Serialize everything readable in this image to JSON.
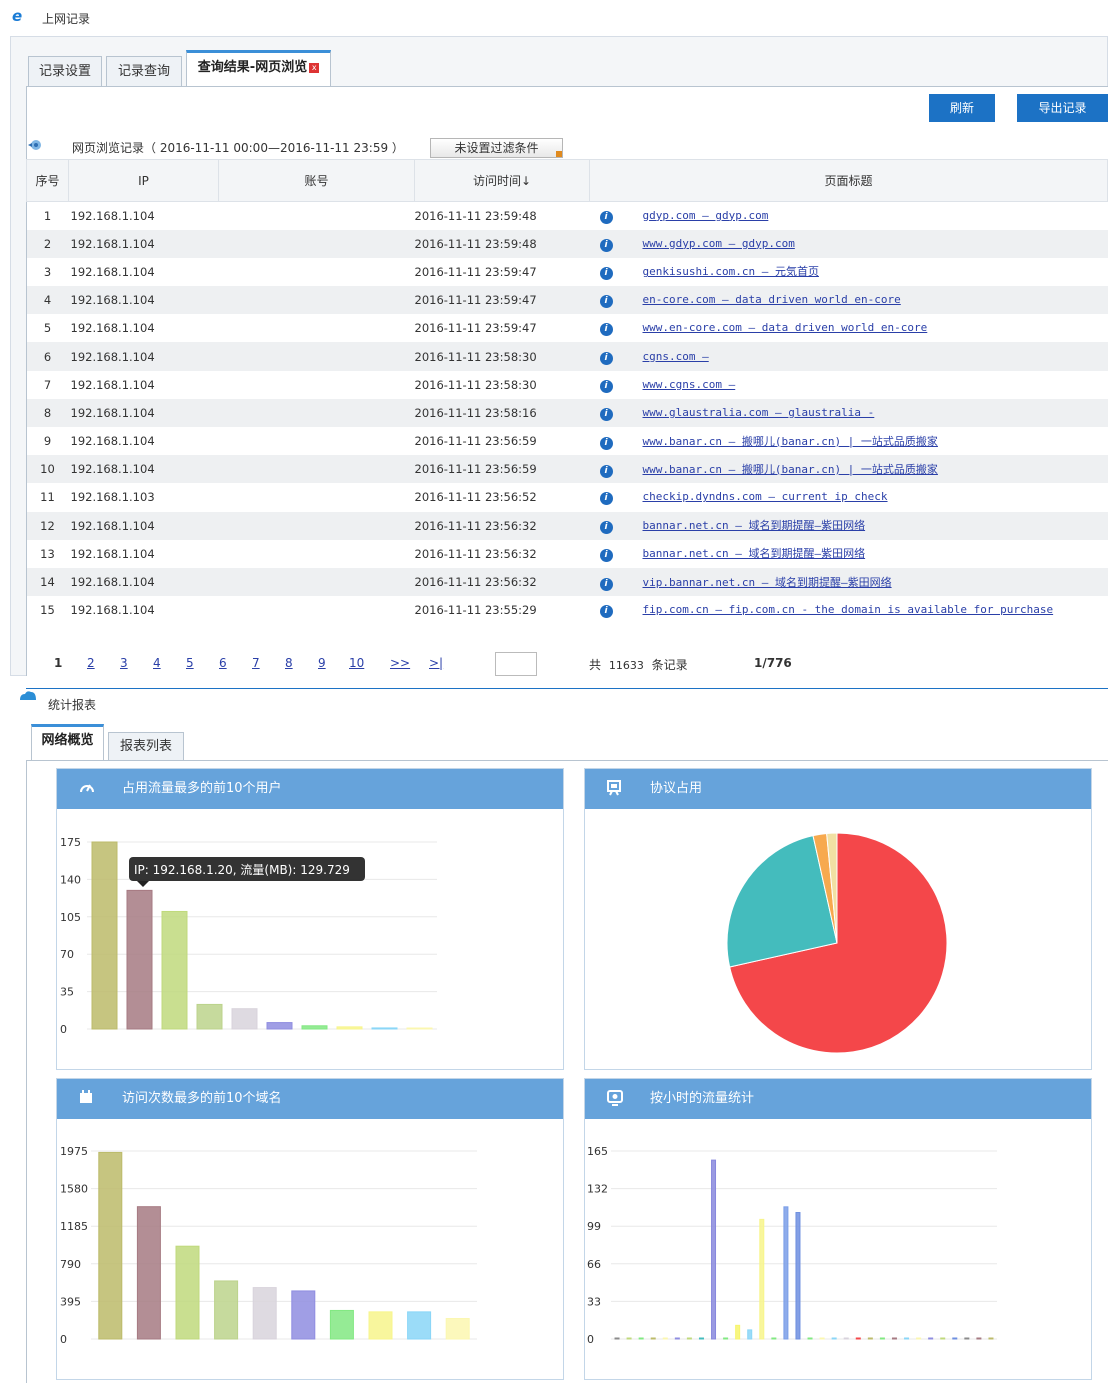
{
  "titlebar": {
    "title": "上网记录"
  },
  "tabs": [
    "记录设置",
    "记录查询",
    "查询结果-网页浏览"
  ],
  "tab_close": "x",
  "buttons": {
    "refresh": "刷新",
    "export": "导出记录"
  },
  "section": {
    "title": "网页浏览记录（ 2016-11-11 00:00—2016-11-11 23:59 ）",
    "filter": "未设置过滤条件"
  },
  "table": {
    "headers": [
      "序号",
      "IP",
      "账号",
      "访问时间↓",
      "页面标题"
    ],
    "rows": [
      {
        "n": "1",
        "ip": "192.168.1.104",
        "account": "",
        "time": "2016-11-11 23:59:48",
        "title": "gdyp.com  —  gdyp.com"
      },
      {
        "n": "2",
        "ip": "192.168.1.104",
        "account": "",
        "time": "2016-11-11 23:59:48",
        "title": "www.gdyp.com  —  gdyp.com"
      },
      {
        "n": "3",
        "ip": "192.168.1.104",
        "account": "",
        "time": "2016-11-11 23:59:47",
        "title": "genkisushi.com.cn  —  元気首页"
      },
      {
        "n": "4",
        "ip": "192.168.1.104",
        "account": "",
        "time": "2016-11-11 23:59:47",
        "title": "en-core.com  —  data driven world en-core"
      },
      {
        "n": "5",
        "ip": "192.168.1.104",
        "account": "",
        "time": "2016-11-11 23:59:47",
        "title": "www.en-core.com  —  data driven world en-core"
      },
      {
        "n": "6",
        "ip": "192.168.1.104",
        "account": "",
        "time": "2016-11-11 23:58:30",
        "title": "cgns.com  —"
      },
      {
        "n": "7",
        "ip": "192.168.1.104",
        "account": "",
        "time": "2016-11-11 23:58:30",
        "title": "www.cgns.com  —"
      },
      {
        "n": "8",
        "ip": "192.168.1.104",
        "account": "",
        "time": "2016-11-11 23:58:16",
        "title": "www.glaustralia.com  —  glaustralia -"
      },
      {
        "n": "9",
        "ip": "192.168.1.104",
        "account": "",
        "time": "2016-11-11 23:56:59",
        "title": "www.banar.cn  —  搬哪儿(banar.cn) | 一站式品质搬家"
      },
      {
        "n": "10",
        "ip": "192.168.1.104",
        "account": "",
        "time": "2016-11-11 23:56:59",
        "title": "www.banar.cn  —  搬哪儿(banar.cn) | 一站式品质搬家"
      },
      {
        "n": "11",
        "ip": "192.168.1.103",
        "account": "",
        "time": "2016-11-11 23:56:52",
        "title": "checkip.dyndns.com  —  current ip check"
      },
      {
        "n": "12",
        "ip": "192.168.1.104",
        "account": "",
        "time": "2016-11-11 23:56:32",
        "title": "bannar.net.cn  —  域名到期提醒—紫田网络"
      },
      {
        "n": "13",
        "ip": "192.168.1.104",
        "account": "",
        "time": "2016-11-11 23:56:32",
        "title": "bannar.net.cn  —  域名到期提醒—紫田网络"
      },
      {
        "n": "14",
        "ip": "192.168.1.104",
        "account": "",
        "time": "2016-11-11 23:56:32",
        "title": "vip.bannar.net.cn  —  域名到期提醒—紫田网络"
      },
      {
        "n": "15",
        "ip": "192.168.1.104",
        "account": "",
        "time": "2016-11-11 23:55:29",
        "title": "fip.com.cn  —  fip.com.cn - the domain is available for purchase"
      }
    ]
  },
  "pager": {
    "pages": [
      "1",
      "2",
      "3",
      "4",
      "5",
      "6",
      "7",
      "8",
      "9",
      "10",
      ">>",
      ">|"
    ],
    "total_prefix": "共",
    "total": "11633",
    "total_suffix": "条记录",
    "position": "1/776"
  },
  "stats": {
    "title": "统计报表",
    "tabs": [
      "网络概览",
      "报表列表"
    ]
  },
  "chart_data": [
    {
      "type": "bar",
      "title": "占用流量最多的前10个用户",
      "values": [
        175,
        129.729,
        110,
        23,
        19,
        6,
        3,
        2,
        1,
        0.5
      ],
      "colors": [
        "#bcbb6a",
        "#a67a82",
        "#c0d97c",
        "#bcd38c",
        "#d8d3dc",
        "#8f8de0",
        "#82e882",
        "#f7f58c",
        "#8ad6f7",
        "#fbf7b0"
      ],
      "yticks": [
        "175",
        "140",
        "105",
        "70",
        "35",
        "0"
      ],
      "ylim": [
        0,
        175
      ],
      "tooltip": "IP: 192.168.1.20, 流量(MB): 129.729"
    },
    {
      "type": "pie",
      "title": "协议占用",
      "values": [
        71.5,
        25,
        2,
        1.5
      ],
      "colors": [
        "#f4474a",
        "#44bcbd",
        "#f7a94e",
        "#f1e0a3"
      ]
    },
    {
      "type": "bar",
      "title": "访问次数最多的前10个域名",
      "values": [
        1960,
        1390,
        975,
        610,
        540,
        505,
        300,
        285,
        285,
        215
      ],
      "colors": [
        "#bcbb6a",
        "#a67a82",
        "#c0d97c",
        "#bcd38c",
        "#d8d3dc",
        "#8f8de0",
        "#82e882",
        "#f7f58c",
        "#8ad6f7",
        "#fbf7b0"
      ],
      "yticks": [
        "1975",
        "1580",
        "1185",
        "790",
        "395",
        "0"
      ],
      "ylim": [
        0,
        1975
      ]
    },
    {
      "type": "bar",
      "title": "按小时的流量统计",
      "values": [
        0.5,
        0.5,
        0.5,
        0.5,
        0.5,
        0.5,
        0.5,
        0.5,
        157,
        0.5,
        12,
        8,
        105,
        0.5,
        116,
        111,
        0.5,
        0.5,
        0.5,
        0.5,
        0.5,
        0.5,
        0.5,
        0.5,
        0.5,
        0.5,
        0.5,
        0.5,
        0.5,
        0.5,
        0.5,
        0.5
      ],
      "colors": [
        "#8b8b8b",
        "#c0d97c",
        "#82e882",
        "#bcbb6a",
        "#fbf7b0",
        "#8f8de0",
        "#c0d97c",
        "#44bcbd",
        "#8888dd",
        "#82e882",
        "#f7f56c",
        "#8ad6f7",
        "#f7f58c",
        "#82e882",
        "#7a9ee8",
        "#6e8fe0",
        "#82e882",
        "#fbf7b0",
        "#8ad6f7",
        "#d8d3dc",
        "#f4474a",
        "#bcbb6a",
        "#82e882",
        "#a67a82",
        "#8ad6f7",
        "#fbf7b0",
        "#8f8de0",
        "#c0d97c",
        "#6e8fe0",
        "#8b8b8b",
        "#a67a82",
        "#bcbb6a"
      ],
      "yticks": [
        "165",
        "132",
        "99",
        "66",
        "33",
        "0"
      ],
      "ylim": [
        0,
        165
      ]
    }
  ]
}
